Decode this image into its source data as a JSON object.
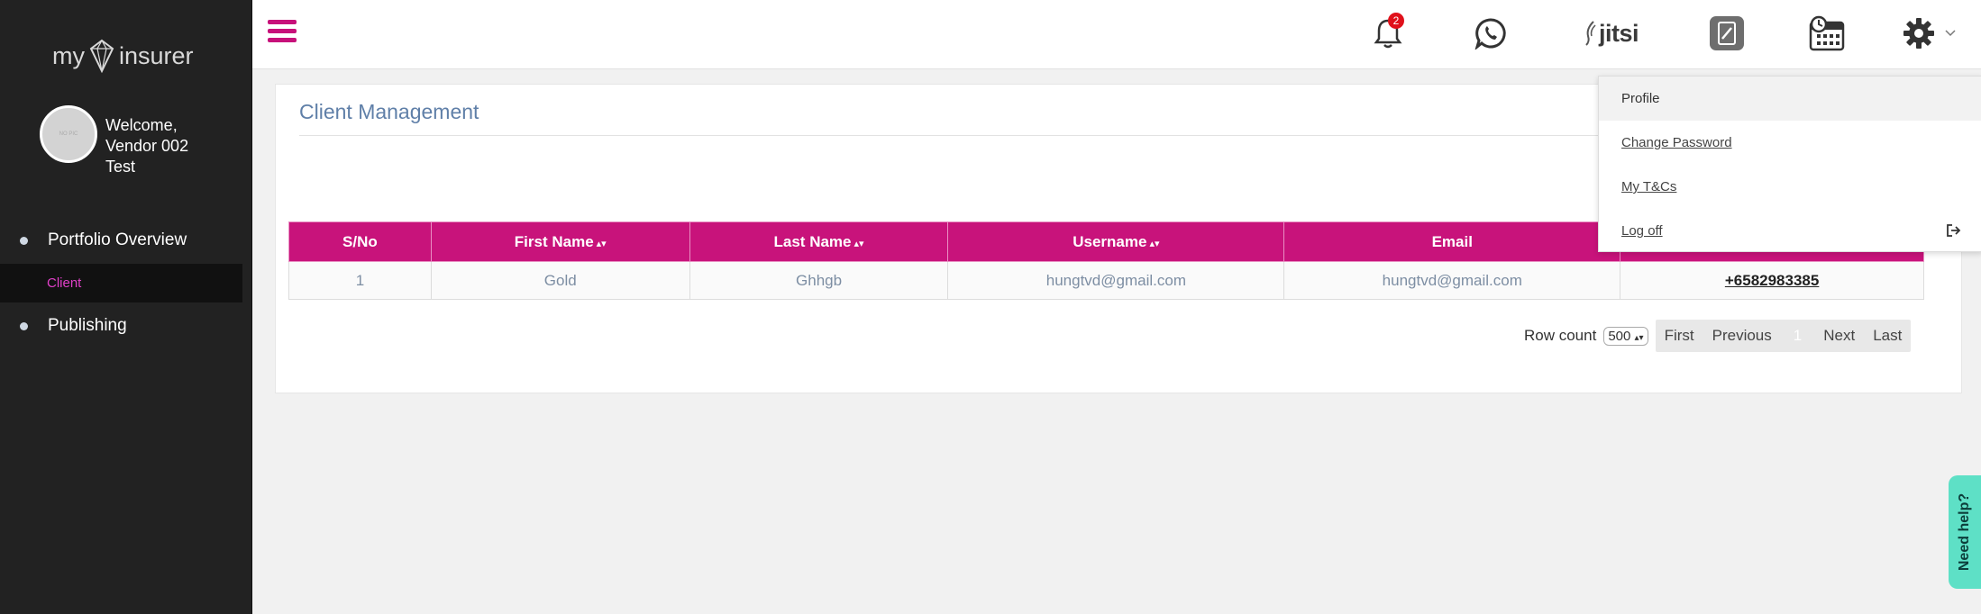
{
  "brand": {
    "logo_left": "my",
    "logo_right": "insurer"
  },
  "user": {
    "welcome": "Welcome,",
    "name_line1": "Vendor 002",
    "name_line2": "Test",
    "avatar_text": "NO PIC"
  },
  "sidebar": {
    "items": [
      {
        "label": "Portfolio Overview"
      },
      {
        "label": "Client"
      },
      {
        "label": "Publishing"
      }
    ]
  },
  "topbar": {
    "notification_count": "2",
    "jitsi_label": "jitsi"
  },
  "page": {
    "title": "Client Management"
  },
  "table": {
    "headers": [
      "S/No",
      "First Name",
      "Last Name",
      "Username",
      "Email",
      ""
    ],
    "rows": [
      [
        "1",
        "Gold",
        "Ghhgb",
        "hungtvd@gmail.com",
        "hungtvd@gmail.com",
        "+6582983385"
      ]
    ]
  },
  "pagination": {
    "row_count_label": "Row count",
    "row_count_value": "500",
    "first": "First",
    "previous": "Previous",
    "current": "1",
    "next": "Next",
    "last": "Last"
  },
  "dropdown": {
    "items": [
      "Profile",
      "Change Password",
      "My T&Cs",
      "Log off"
    ]
  },
  "help": {
    "label": "Need help?"
  },
  "colors": {
    "accent": "#c8137b",
    "sidebar": "#222222",
    "help": "#5ee0c6"
  }
}
